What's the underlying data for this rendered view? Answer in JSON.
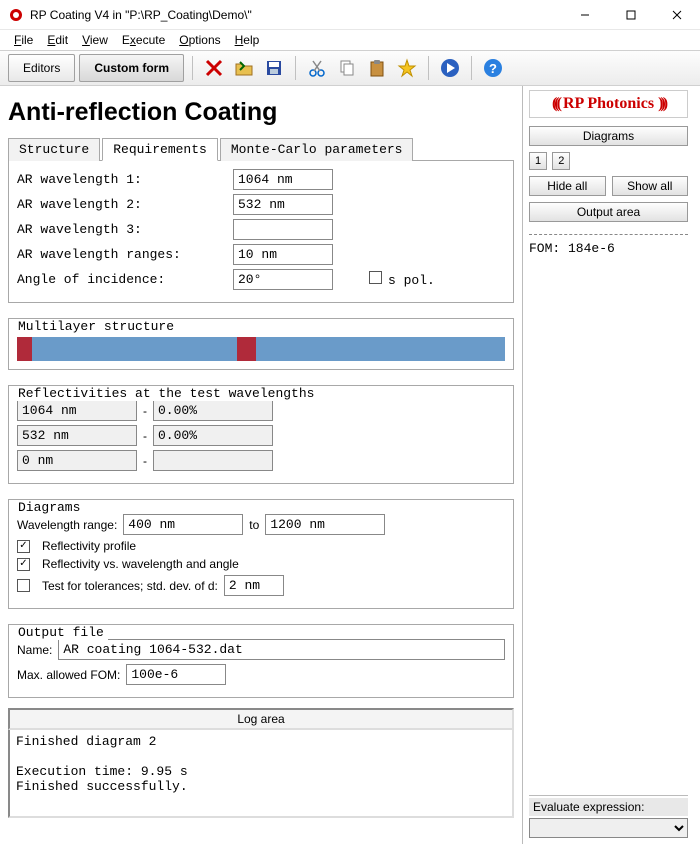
{
  "window": {
    "title": "RP Coating V4 in \"P:\\RP_Coating\\Demo\\\""
  },
  "menu": {
    "file": "File",
    "edit": "Edit",
    "view": "View",
    "execute": "Execute",
    "options": "Options",
    "help": "Help"
  },
  "toolbar": {
    "editors": "Editors",
    "custom_form": "Custom form"
  },
  "page_title": "Anti-reflection Coating",
  "tabs": {
    "structure": "Structure",
    "requirements": "Requirements",
    "monte": "Monte-Carlo parameters"
  },
  "fields": {
    "ar1_label": "AR wavelength 1:",
    "ar1_value": "1064 nm",
    "ar2_label": "AR wavelength 2:",
    "ar2_value": "532 nm",
    "ar3_label": "AR wavelength 3:",
    "ar3_value": "",
    "arr_label": "AR wavelength ranges:",
    "arr_value": "10 nm",
    "aoi_label": "Angle of incidence:",
    "aoi_value": "20°",
    "spol_label": "s pol."
  },
  "multilayer_title": "Multilayer structure",
  "refl_title": "Reflectivities at the test wavelengths",
  "refl_rows": [
    {
      "wl": "1064 nm",
      "dash": "-",
      "pct": "0.00%"
    },
    {
      "wl": "532 nm",
      "dash": "-",
      "pct": "0.00%"
    },
    {
      "wl": "0 nm",
      "dash": "-",
      "pct": ""
    }
  ],
  "diag": {
    "title": "Diagrams",
    "range_label": "Wavelength range:",
    "range_from": "400 nm",
    "range_to_label": "to",
    "range_to": "1200 nm",
    "opt1": "Reflectivity profile",
    "opt2": "Reflectivity vs. wavelength and angle",
    "opt3": "Test for tolerances; std. dev. of d:",
    "opt3_val": "2 nm"
  },
  "out": {
    "title": "Output file",
    "name_label": "Name:",
    "name_value": "AR coating 1064-532.dat",
    "fom_label": "Max. allowed FOM:",
    "fom_value": "100e-6"
  },
  "log": {
    "header": "Log area",
    "body": "Finished diagram 2\n\nExecution time: 9.95 s\nFinished successfully."
  },
  "side": {
    "logo": "RP Photonics",
    "diagrams_btn": "Diagrams",
    "sq1": "1",
    "sq2": "2",
    "hide_all": "Hide all",
    "show_all": "Show all",
    "output_area": "Output area",
    "output_text": "FOM: 184e-6",
    "eval_label": "Evaluate expression:"
  }
}
